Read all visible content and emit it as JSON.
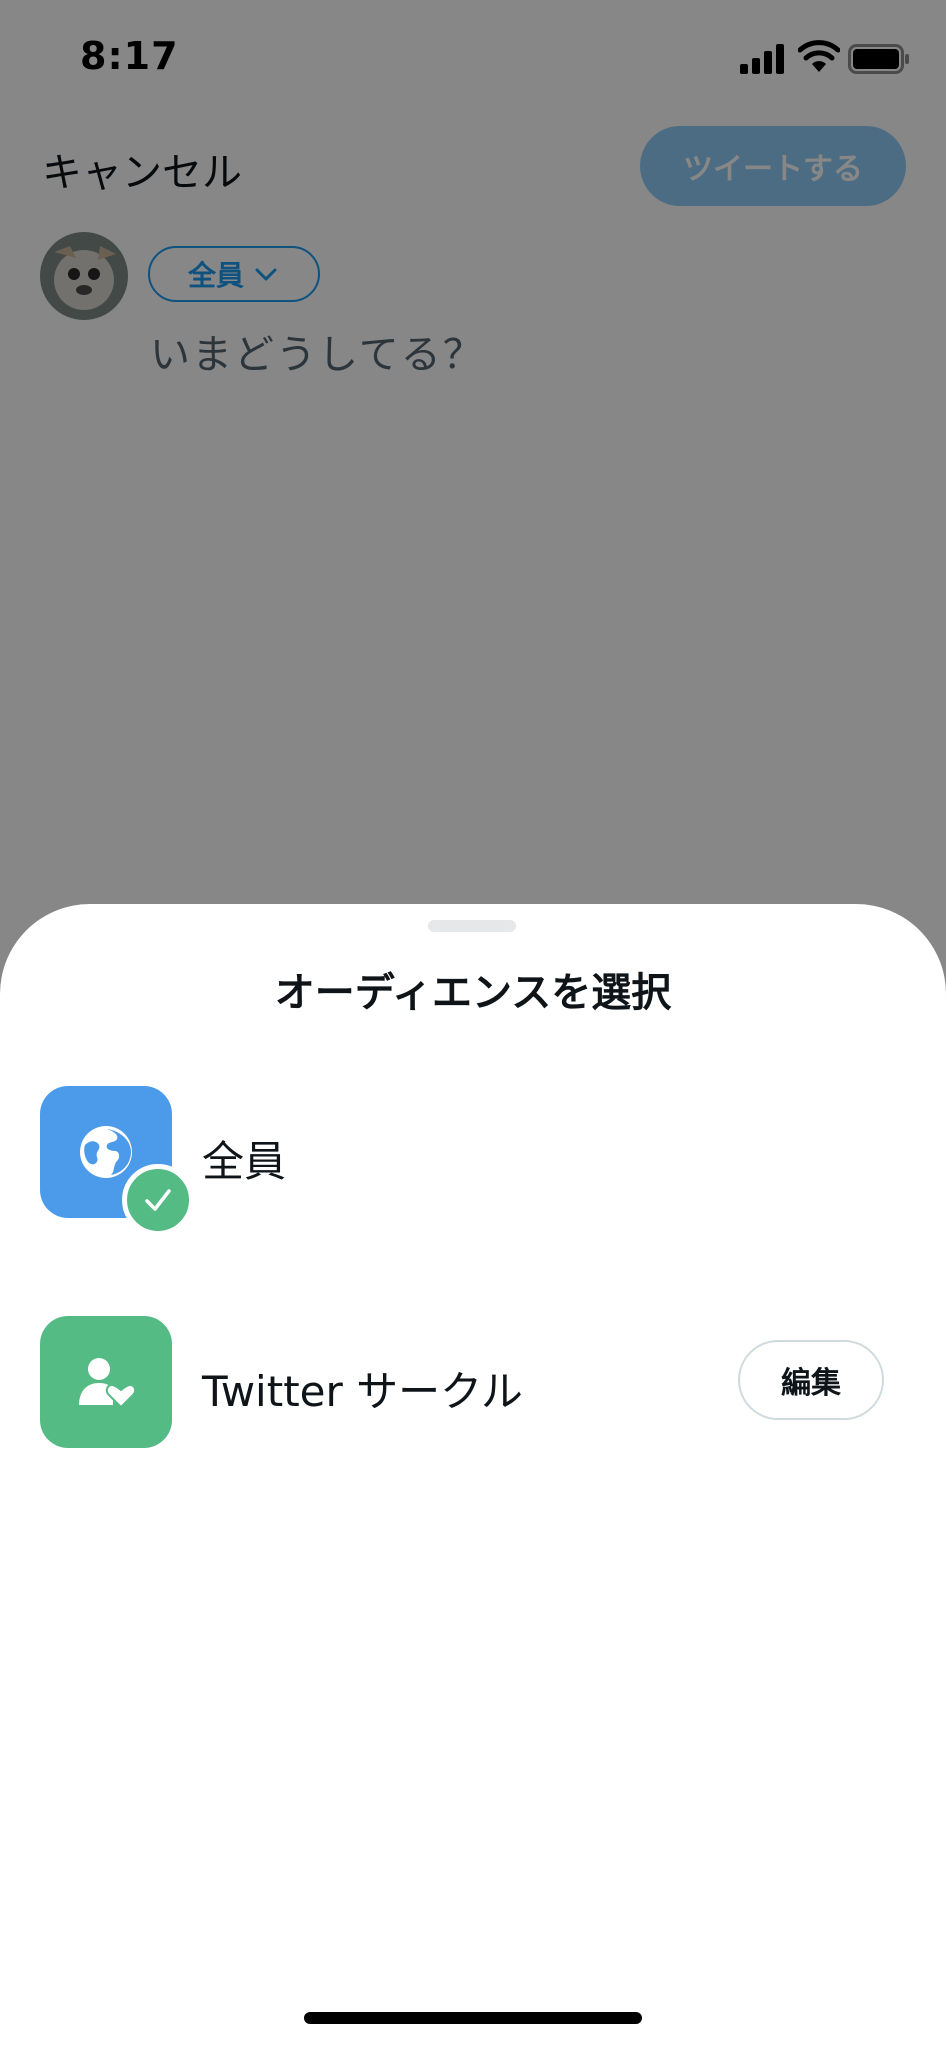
{
  "status_bar": {
    "time": "8:17"
  },
  "compose": {
    "cancel_label": "キャンセル",
    "tweet_label": "ツイートする",
    "audience_label": "全員",
    "placeholder": "いまどうしてる？"
  },
  "sheet": {
    "title": "オーディエンスを選択",
    "options": [
      {
        "label": "全員",
        "icon": "globe-icon",
        "selected": true
      },
      {
        "label": "Twitter サークル",
        "icon": "person-heart-icon",
        "selected": false,
        "action_label": "編集"
      }
    ]
  },
  "colors": {
    "accent": "#1d9bf0",
    "everyone_icon_bg": "#4c9bea",
    "circle_icon_bg": "#55bb85"
  }
}
